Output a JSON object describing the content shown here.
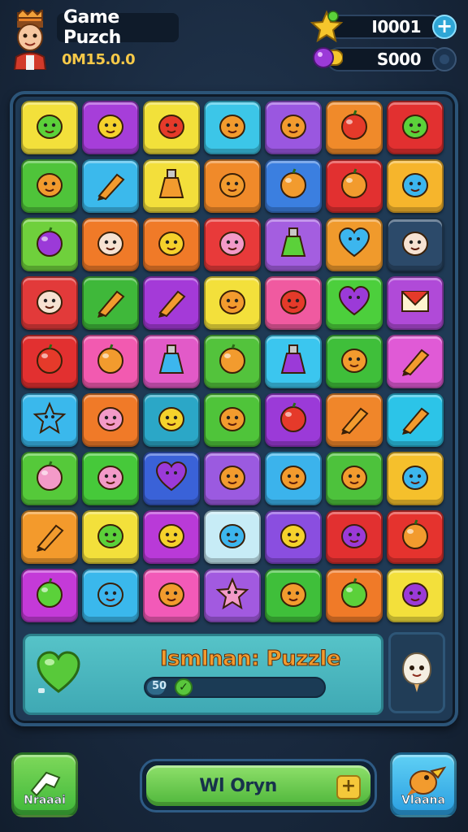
{
  "header": {
    "title": "Game Puzch",
    "score": "0M15.0.0",
    "resources": [
      {
        "value": "I0001",
        "icon": "star-icon",
        "action": "+"
      },
      {
        "value": "S000",
        "icon": "potion-icon"
      }
    ]
  },
  "board": {
    "rows": [
      [
        {
          "color": "#f3e03b",
          "icon": "green-blob-face-icon"
        },
        {
          "color": "#a63ed9",
          "icon": "sun-face-icon"
        },
        {
          "color": "#f2e13a",
          "icon": "red-dragon-icon"
        },
        {
          "color": "#3cc6e8",
          "icon": "broccoli-icon"
        },
        {
          "color": "#9a57e0",
          "icon": "orange-peel-icon"
        },
        {
          "color": "#f08a2a",
          "icon": "tomato-icon"
        },
        {
          "color": "#e23030",
          "icon": "green-spiky-icon"
        }
      ],
      [
        {
          "color": "#4fc43a",
          "icon": "fox-icon"
        },
        {
          "color": "#3bb9ec",
          "icon": "pencil-icon"
        },
        {
          "color": "#f3df3b",
          "icon": "potion-bottle-icon"
        },
        {
          "color": "#f08a2a",
          "icon": "clam-icon"
        },
        {
          "color": "#3b7fe0",
          "icon": "orange-ball-icon"
        },
        {
          "color": "#e23030",
          "icon": "melon-icon"
        },
        {
          "color": "#f6b52c",
          "icon": "pufferfish-icon"
        }
      ],
      [
        {
          "color": "#6fd03c",
          "icon": "purple-drop-icon"
        },
        {
          "color": "#f07a28",
          "icon": "pig-face-icon"
        },
        {
          "color": "#f07a28",
          "icon": "yellow-chick-icon"
        },
        {
          "color": "#e83a3a",
          "icon": "pink-bunny-icon"
        },
        {
          "color": "#a45ee0",
          "icon": "green-bottle-icon"
        },
        {
          "color": "#f09a2c",
          "icon": "blue-heart-icon"
        },
        {
          "color": "#2c4a6a",
          "icon": "cat-face-icon"
        }
      ],
      [
        {
          "color": "#e23a3a",
          "icon": "white-cat-icon"
        },
        {
          "color": "#3fb83a",
          "icon": "rocket-icon"
        },
        {
          "color": "#a43ad8",
          "icon": "capsule-icon"
        },
        {
          "color": "#f3e03b",
          "icon": "orange-cookie-icon"
        },
        {
          "color": "#f05aa0",
          "icon": "red-ninja-icon"
        },
        {
          "color": "#4ccf3c",
          "icon": "purple-heart-icon"
        },
        {
          "color": "#b04ad8",
          "icon": "envelope-icon"
        }
      ],
      [
        {
          "color": "#e23030",
          "icon": "red-ball-icon"
        },
        {
          "color": "#f25ab0",
          "icon": "orange-balloon-icon"
        },
        {
          "color": "#e25ac8",
          "icon": "blue-flask-icon"
        },
        {
          "color": "#53c33c",
          "icon": "orange-fruit-icon"
        },
        {
          "color": "#3bc6ef",
          "icon": "purple-potion-icon"
        },
        {
          "color": "#3fbf3a",
          "icon": "lion-face-icon"
        },
        {
          "color": "#e05ad6",
          "icon": "carrot-rocket-icon"
        }
      ],
      [
        {
          "color": "#3ab8ec",
          "icon": "starfish-icon"
        },
        {
          "color": "#f07a28",
          "icon": "pink-blob-icon"
        },
        {
          "color": "#2ba7c7",
          "icon": "cheese-icon"
        },
        {
          "color": "#4fc43a",
          "icon": "sushi-icon"
        },
        {
          "color": "#9b3ad8",
          "icon": "red-apple-icon"
        },
        {
          "color": "#f0862a",
          "icon": "pencil-icon"
        },
        {
          "color": "#2cc4e8",
          "icon": "pencil-icon"
        }
      ],
      [
        {
          "color": "#55c93a",
          "icon": "pink-ball-icon"
        },
        {
          "color": "#46c93a",
          "icon": "pink-face-icon"
        },
        {
          "color": "#3a62d8",
          "icon": "purple-heart-ring-icon"
        },
        {
          "color": "#9b5ae0",
          "icon": "magnet-icon"
        },
        {
          "color": "#3bb3ec",
          "icon": "lion-cub-icon"
        },
        {
          "color": "#4dc23c",
          "icon": "orange-monster-icon"
        },
        {
          "color": "#f5c02c",
          "icon": "blue-fish-icon"
        }
      ],
      [
        {
          "color": "#f39a2c",
          "icon": "pencil-icon"
        },
        {
          "color": "#f3e03b",
          "icon": "green-virus-icon"
        },
        {
          "color": "#b93ad8",
          "icon": "yellow-sun-icon"
        },
        {
          "color": "#c7ecf6",
          "icon": "blue-hat-icon"
        },
        {
          "color": "#8a4ee0",
          "icon": "lemon-icon"
        },
        {
          "color": "#e23030",
          "icon": "purple-eyes-icon"
        },
        {
          "color": "#e5332e",
          "icon": "orange-fruit-icon"
        }
      ],
      [
        {
          "color": "#c43ad8",
          "icon": "green-leaf-icon"
        },
        {
          "color": "#3ab8ec",
          "icon": "clownfish-icon"
        },
        {
          "color": "#f25ab8",
          "icon": "orange-face-icon"
        },
        {
          "color": "#a25ae0",
          "icon": "pink-star-face-icon"
        },
        {
          "color": "#3fbf3a",
          "icon": "bear-face-icon"
        },
        {
          "color": "#f07a28",
          "icon": "green-slime-icon"
        },
        {
          "color": "#f3e03b",
          "icon": "purple-wizard-icon"
        }
      ]
    ]
  },
  "panel": {
    "level_name": "Ismlnan: Puzzle",
    "progress_label": "50",
    "progress_fraction": 0.1,
    "heart_icon": "green-heart-icon",
    "side_icon": "ghost-icon"
  },
  "bottom": {
    "left_label": "Nraaai",
    "main_label": "Wl Oryn",
    "main_action": "+",
    "right_label": "Vlaana"
  },
  "colors": {
    "board_bg": "#1f3a55",
    "accent_green": "#4fb63b",
    "accent_orange": "#f29b2e"
  }
}
